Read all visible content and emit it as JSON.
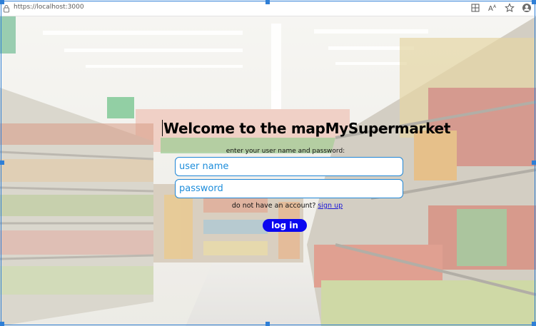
{
  "browser": {
    "url": "https://localhost:3000",
    "icons": [
      "lock-icon",
      "reading-view-icon",
      "read-aloud-icon",
      "favorite-star-icon",
      "profile-icon"
    ]
  },
  "login": {
    "title": "Welcome to the mapMySupermarket",
    "instruction": "enter your user name and password:",
    "username_placeholder": "user name",
    "password_placeholder": "password",
    "signup_prompt": "do not have an account?",
    "signup_link": "sign up",
    "login_button": "log in"
  },
  "colors": {
    "field_border": "#1f86d6",
    "field_text": "#1d8ddb",
    "button_bg": "#0a07f0",
    "link": "#1a16d8",
    "selection": "#2f7fd6"
  }
}
